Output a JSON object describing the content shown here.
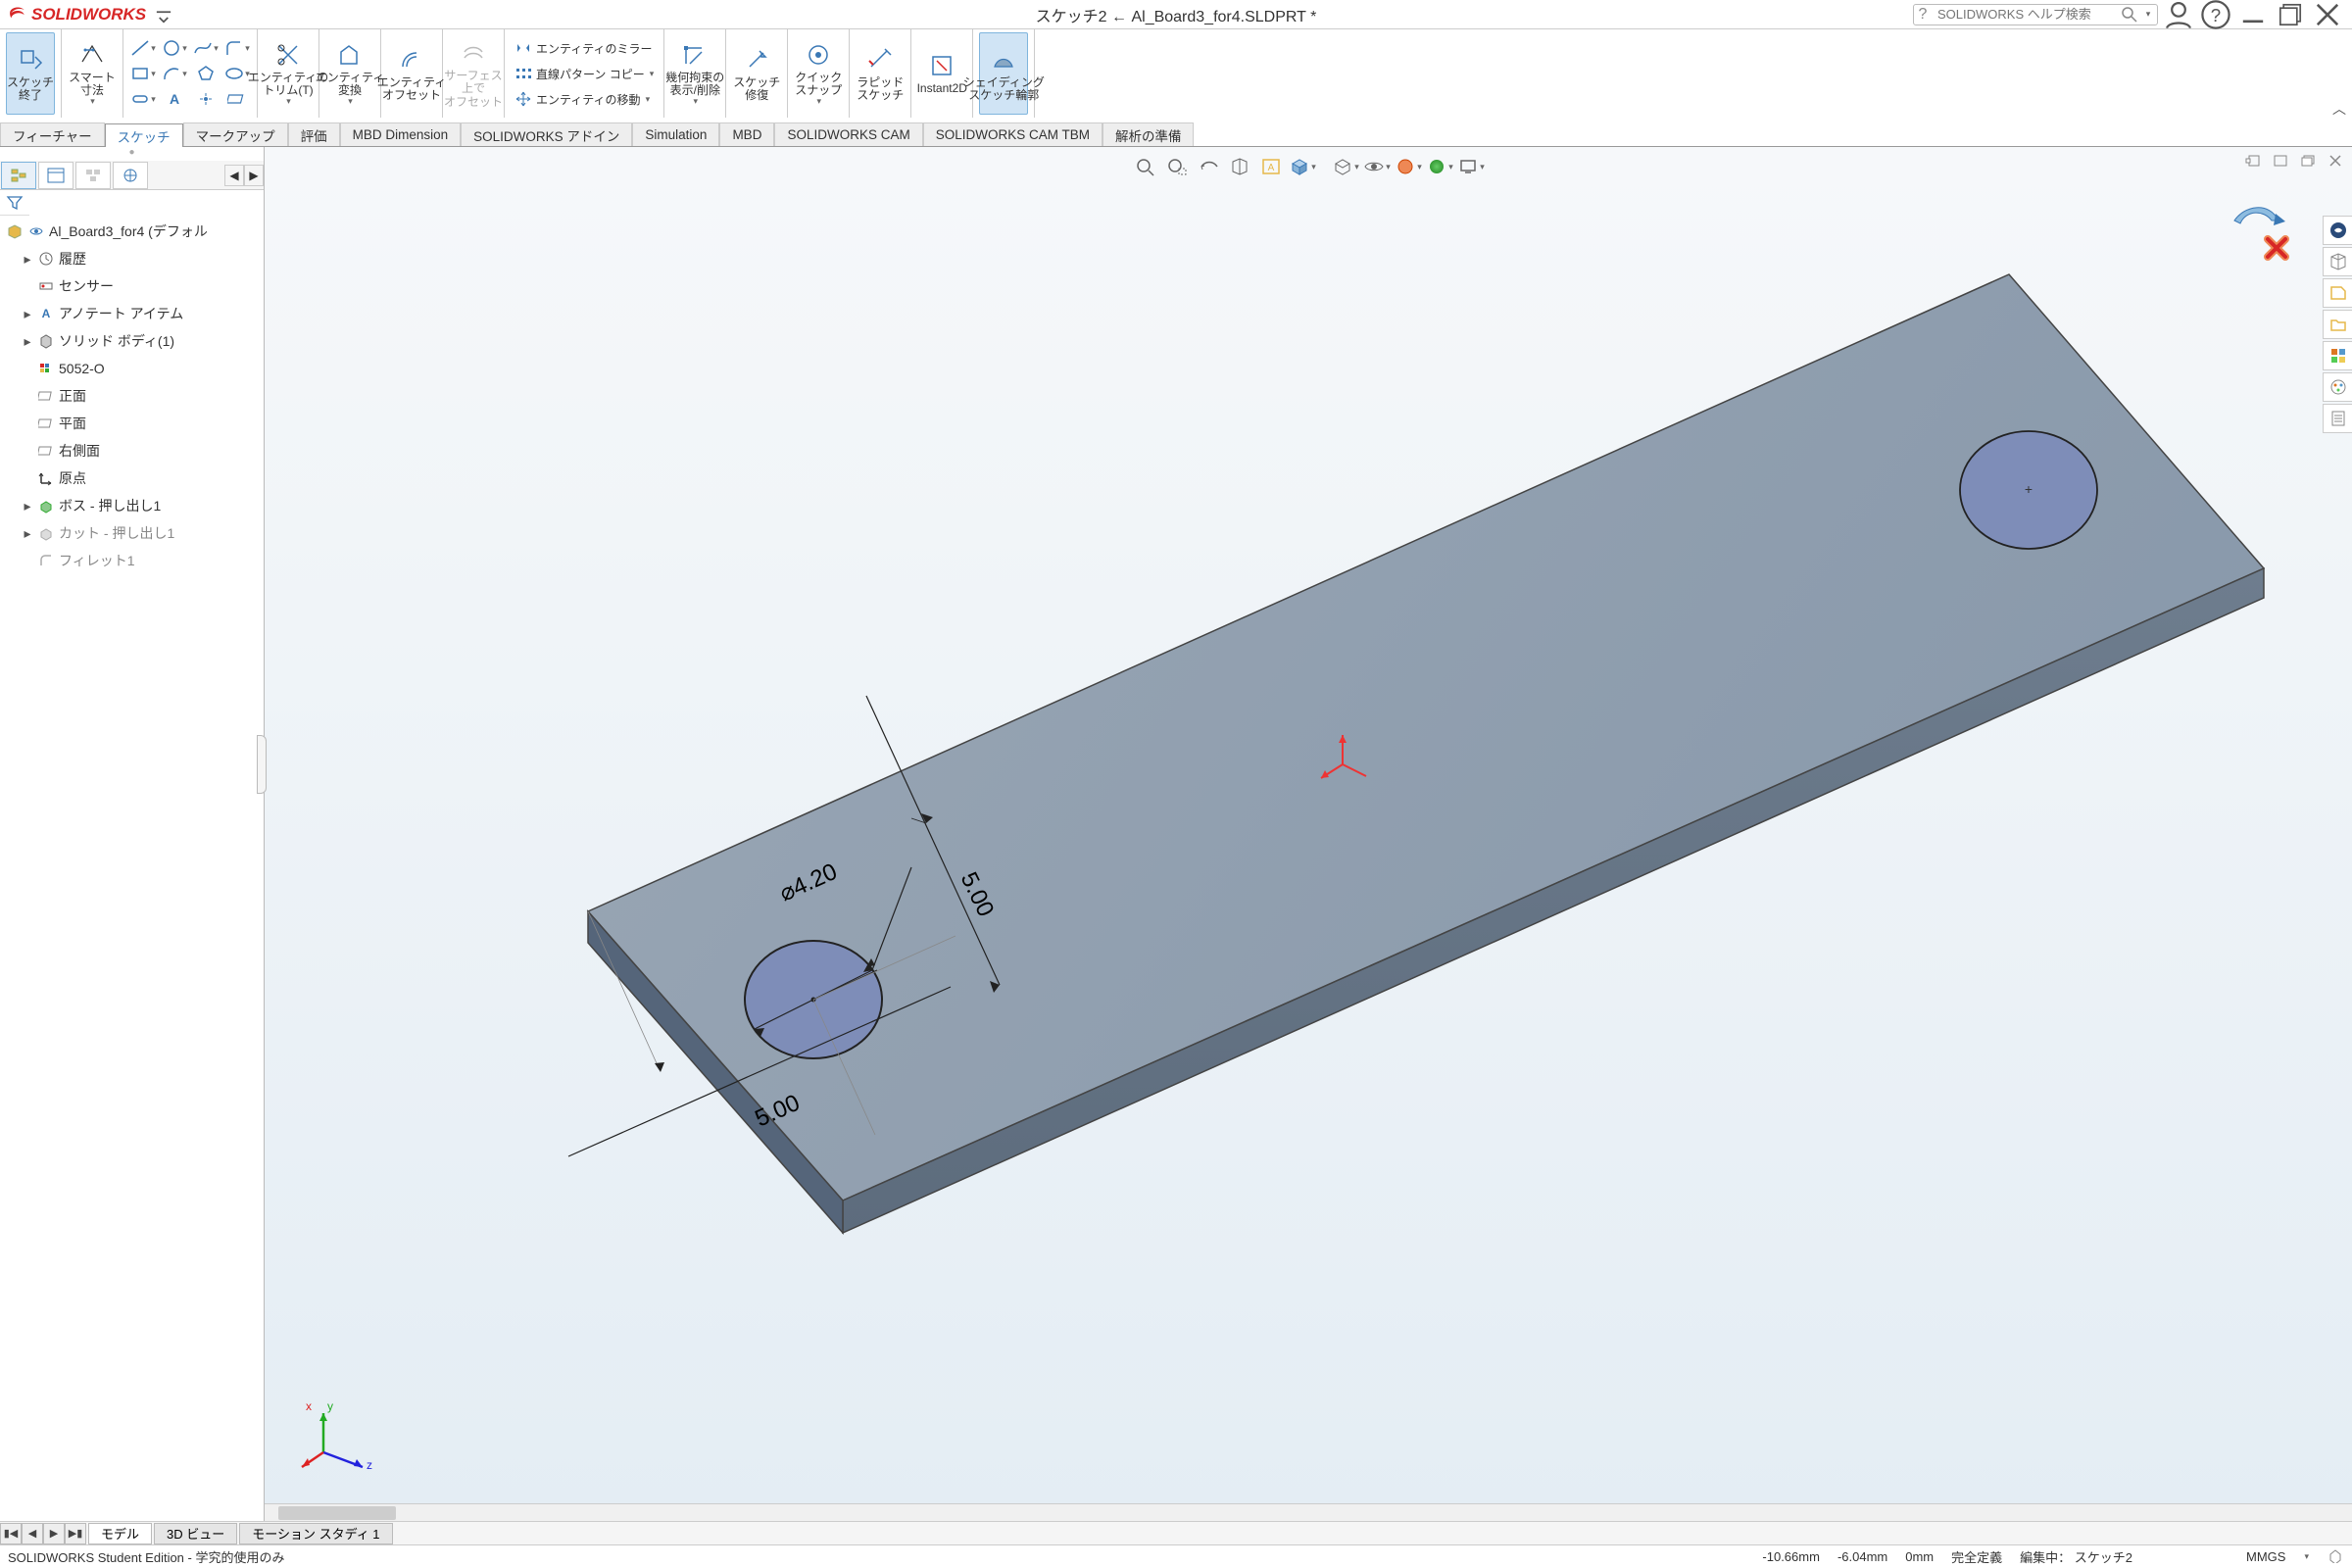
{
  "app": {
    "brand": "SOLIDWORKS",
    "title": "スケッチ2 ← Al_Board3_for4.SLDPRT *",
    "search_placeholder": "SOLIDWORKS ヘルプ検索"
  },
  "ribbon": {
    "exit_sketch": "スケッチ\n終了",
    "smart_dim": "スマート\n寸法",
    "trim": "エンティティの\nトリム(T)",
    "convert": "エンティティ\n変換",
    "offset": "エンティティ\nオフセット",
    "surface_offset": "サーフェス\n上で\nオフセット",
    "mirror": "エンティティのミラー",
    "pattern": "直線パターン コピー",
    "move": "エンティティの移動",
    "constraints": "幾何拘束の\n表示/削除",
    "repair": "スケッチ\n修復",
    "quicksnap": "クイックスナップ",
    "rapid": "ラピッドスケッチ",
    "instant2d": "Instant2D",
    "shading": "シェイディング\nスケッチ輪郭"
  },
  "tabs": {
    "t0": "フィーチャー",
    "t1": "スケッチ",
    "t2": "マークアップ",
    "t3": "評価",
    "t4": "MBD Dimension",
    "t5": "SOLIDWORKS アドイン",
    "t6": "Simulation",
    "t7": "MBD",
    "t8": "SOLIDWORKS CAM",
    "t9": "SOLIDWORKS CAM TBM",
    "t10": "解析の準備"
  },
  "tree": {
    "root": "Al_Board3_for4 (デフォル",
    "history": "履歴",
    "sensor": "センサー",
    "annot": "アノテート アイテム",
    "solid": "ソリッド ボディ(1)",
    "material": "5052-O",
    "front": "正面",
    "top": "平面",
    "right": "右側面",
    "origin": "原点",
    "boss": "ボス - 押し出し1",
    "cut": "カット - 押し出し1",
    "fillet": "フィレット1"
  },
  "dimensions": {
    "diameter": "⌀4.20",
    "dim_v": "5.00",
    "dim_h": "5.00"
  },
  "triad_labels": {
    "x": "x",
    "y": "y",
    "z": "z"
  },
  "bottom_tabs": {
    "t0": "モデル",
    "t1": "3D ビュー",
    "t2": "モーション スタディ 1"
  },
  "status": {
    "left": "SOLIDWORKS Student Edition - 学究的使用のみ",
    "coord_x": "-10.66mm",
    "coord_y": "-6.04mm",
    "coord_z": "0mm",
    "def": "完全定義",
    "editing": "編集中：",
    "sketch": "スケッチ2",
    "units": "MMGS"
  }
}
